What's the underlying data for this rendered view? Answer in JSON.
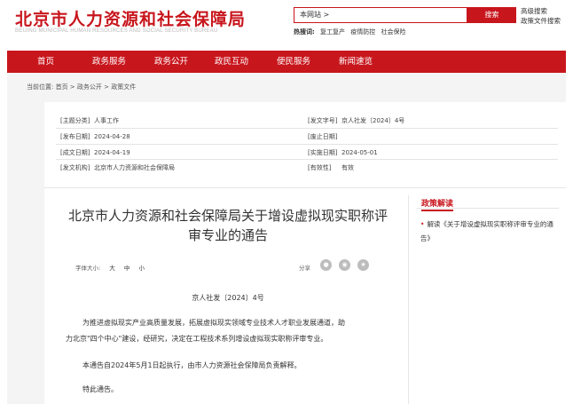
{
  "header": {
    "title": "北京市人力资源和社会保障局",
    "subtitle": "BEIJING MUNICIPAL HUMAN RESOURCES AND SOCIAL SECURITY BUREAU",
    "search_scope": "本网站 >",
    "search_button": "搜索",
    "advanced_search": "高级搜索",
    "policy_search": "政策文件搜索",
    "hot_label": "热搜词:",
    "hot_words": [
      "复工复产",
      "疫情防控",
      "社会保险"
    ]
  },
  "nav": {
    "items": [
      "首页",
      "政务服务",
      "政务公开",
      "政民互动",
      "便民服务",
      "新闻速览"
    ]
  },
  "breadcrumb": "当前位置: 首页 > 政务公开 > 政策文件",
  "meta": {
    "topic_key": "[主题分类]",
    "topic_val": "人事工作",
    "docno_key": "[发文字号]",
    "docno_val": "京人社发〔2024〕4号",
    "pubdate_key": "[发布日期]",
    "pubdate_val": "2024-04-28",
    "abolish_key": "[废止日期]",
    "abolish_val": "",
    "written_key": "[成文日期]",
    "written_val": "2024-04-19",
    "effective_key": "[实施日期]",
    "effective_val": "2024-05-01",
    "issuer_key": "[发文机构]",
    "issuer_val": "北京市人力资源和社会保障局",
    "validity_key": "[有效性]",
    "validity_val": "有效"
  },
  "article": {
    "title": "北京市人力资源和社会保障局关于增设虚拟现实职称评审专业的通告",
    "font_size_label": "字体大小:",
    "size_large": "大",
    "size_medium": "中",
    "size_small": "小",
    "share_label": "分享",
    "doc_number": "京人社发〔2024〕4号",
    "para1_line1": "为推进虚拟现实产业高质量发展，拓展虚拟现实领域专业技术人才职业发展通道，助",
    "para1_line2": "力北京\"四个中心\"建设，经研究，决定在工程技术系列增设虚拟现实职称评审专业。",
    "para2": "本通告自2024年5月1日起执行，由市人力资源社会保障局负责解释。",
    "para3": "特此通告。"
  },
  "sidebar": {
    "title": "政策解读",
    "item": "解读《关于增设虚拟现实职称评审专业的通告》"
  },
  "colors": {
    "brand": "#c8161d"
  }
}
